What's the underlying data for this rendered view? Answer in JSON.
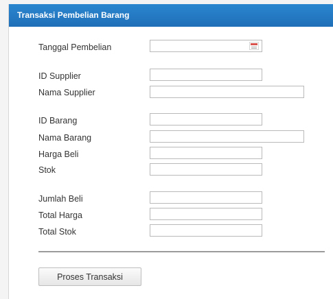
{
  "window": {
    "title": "Transaksi Pembelian Barang"
  },
  "form": {
    "tanggal_pembelian": {
      "label": "Tanggal Pembelian",
      "value": ""
    },
    "id_supplier": {
      "label": "ID Supplier",
      "value": ""
    },
    "nama_supplier": {
      "label": "Nama Supplier",
      "value": ""
    },
    "id_barang": {
      "label": "ID Barang",
      "value": ""
    },
    "nama_barang": {
      "label": "Nama Barang",
      "value": ""
    },
    "harga_beli": {
      "label": "Harga Beli",
      "value": ""
    },
    "stok": {
      "label": "Stok",
      "value": ""
    },
    "jumlah_beli": {
      "label": "Jumlah Beli",
      "value": ""
    },
    "total_harga": {
      "label": "Total Harga",
      "value": ""
    },
    "total_stok": {
      "label": "Total Stok",
      "value": ""
    }
  },
  "actions": {
    "proses_label": "Proses Transaksi"
  },
  "icons": {
    "date_picker": "calendar-icon"
  }
}
